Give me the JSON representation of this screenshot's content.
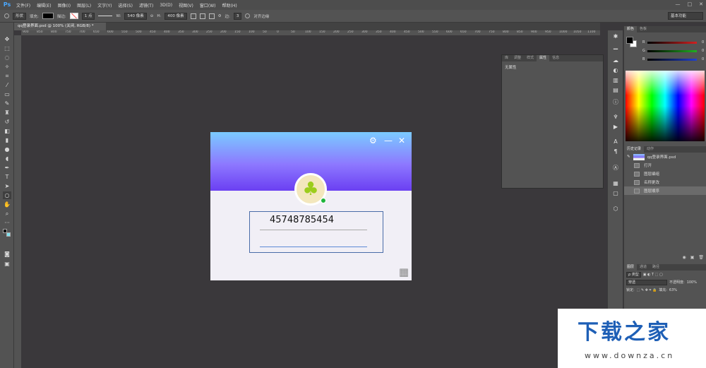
{
  "app": {
    "logo": "Ps"
  },
  "menu": [
    "文件(F)",
    "编辑(E)",
    "图像(I)",
    "图层(L)",
    "文字(Y)",
    "选择(S)",
    "滤镜(T)",
    "3D(D)",
    "视图(V)",
    "窗口(W)",
    "帮助(H)"
  ],
  "window_controls": [
    "—",
    "□",
    "✕"
  ],
  "options": {
    "mode": "形状",
    "fill_label": "填充:",
    "stroke_label": "描边:",
    "stroke_width": "1 点",
    "w_label": "W:",
    "w_value": "540 像素",
    "link": "⊖",
    "h_label": "H:",
    "h_value": "400 像素",
    "radius_label": "边:",
    "radius_value": "3",
    "align_edges": "对齐边缘",
    "workspace": "基本功能"
  },
  "document_tab": "qq登录界面.psd @ 100% (关闭, RGB/8) *",
  "ruler_ticks": [
    "900",
    "850",
    "800",
    "750",
    "700",
    "650",
    "600",
    "550",
    "500",
    "450",
    "400",
    "350",
    "300",
    "250",
    "200",
    "150",
    "100",
    "50",
    "0",
    "50",
    "100",
    "150",
    "200",
    "250",
    "300",
    "350",
    "400",
    "450",
    "500",
    "550",
    "600",
    "650",
    "700",
    "750",
    "800",
    "850",
    "900",
    "950",
    "1000",
    "1050",
    "1100"
  ],
  "login": {
    "settings_icon": "⚙",
    "minimize_icon": "—",
    "close_icon": "✕",
    "avatar_icon": "♣",
    "account": "45748785454",
    "qr_icon": "▦"
  },
  "properties_panel": {
    "tabs": [
      "库",
      "调整",
      "样式",
      "属性",
      "信息"
    ],
    "active_tab": "属性",
    "body": "无属性"
  },
  "color_panel": {
    "tabs": [
      "颜色",
      "色板"
    ],
    "sliders": [
      {
        "label": "R",
        "value": "0",
        "color": "#d22020"
      },
      {
        "label": "G",
        "value": "0",
        "color": "#20b020"
      },
      {
        "label": "B",
        "value": "0",
        "color": "#2040d0"
      }
    ]
  },
  "history_panel": {
    "tabs": [
      "历史记录",
      "动作"
    ],
    "snapshot": "qq登录界面.psd",
    "items": [
      "打开",
      "图层编组",
      "名称更改",
      "图层顺序"
    ]
  },
  "layers_panel": {
    "tabs": [
      "图层",
      "通道",
      "路径"
    ],
    "kind": "ρ 类型",
    "blend": "穿透",
    "opacity_label": "不透明度:",
    "opacity": "100%",
    "lock_label": "锁定:",
    "fill_label": "填充:",
    "fill": "63%"
  },
  "watermark": {
    "title": "下载之家",
    "url": "www.downza.cn"
  }
}
